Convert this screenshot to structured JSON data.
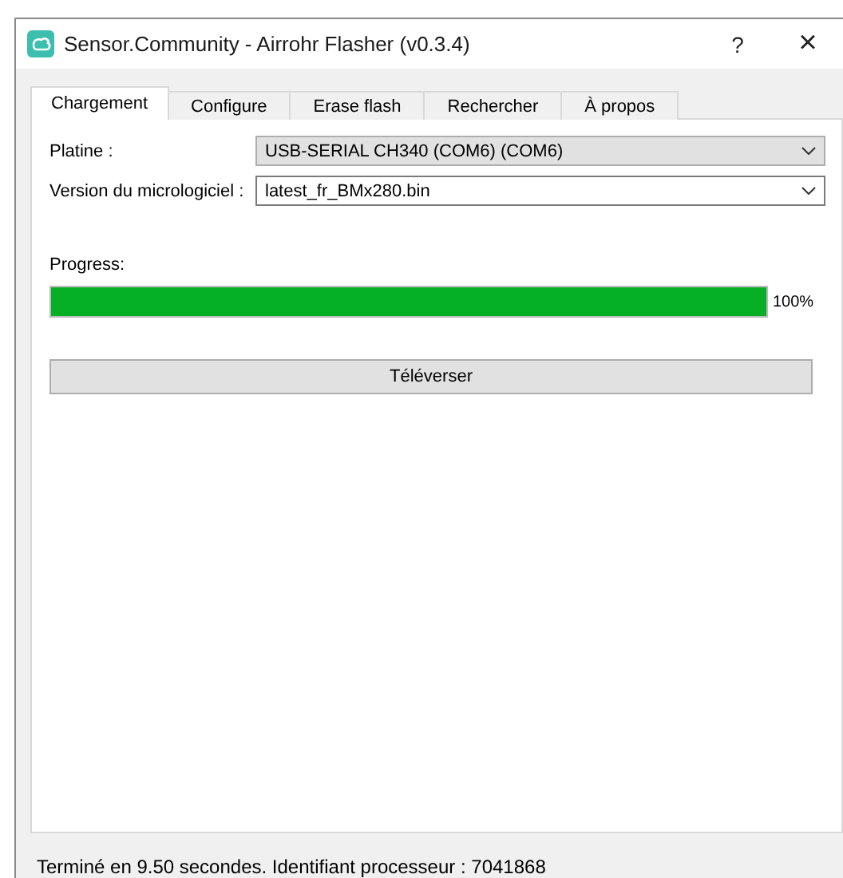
{
  "window": {
    "title": "Sensor.Community - Airrohr Flasher (v0.3.4)",
    "help": "?",
    "close": "×"
  },
  "tabs": [
    {
      "label": "Chargement",
      "selected": true
    },
    {
      "label": "Configure",
      "selected": false
    },
    {
      "label": "Erase flash",
      "selected": false
    },
    {
      "label": "Rechercher",
      "selected": false
    },
    {
      "label": "À propos",
      "selected": false
    }
  ],
  "form": [
    {
      "label": "Platine :",
      "value": "USB-SERIAL CH340 (COM6) (COM6)",
      "kind": "dropdown"
    },
    {
      "label": "Version du micrologiciel :",
      "value": "latest_fr_BMx280.bin",
      "kind": "editable"
    }
  ],
  "progress": {
    "label": "Progress:",
    "level": 1,
    "reading": "100%"
  },
  "upload_button": "Téléverser",
  "status_bar": "Terminé en 9.50 secondes. Identifiant processeur : 7041868"
}
